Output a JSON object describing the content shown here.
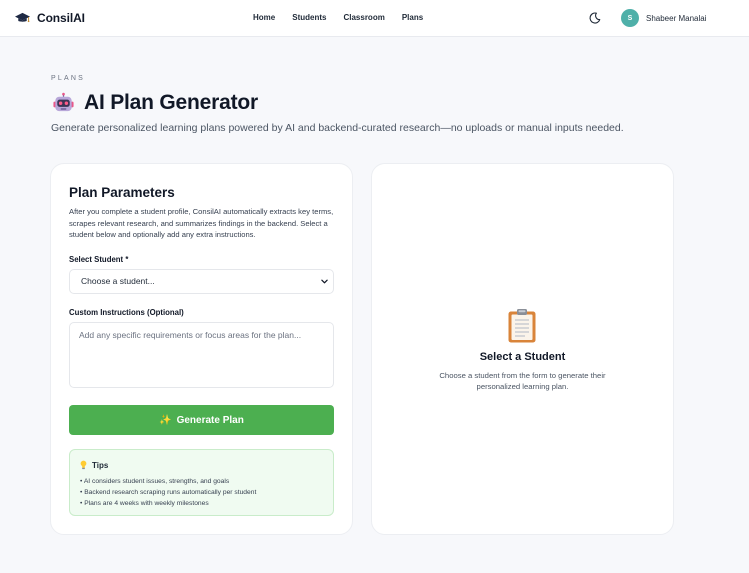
{
  "nav": {
    "brand": "ConsilAI",
    "links": [
      "Home",
      "Students",
      "Classroom",
      "Plans"
    ],
    "avatar_initial": "S",
    "user_name": "Shabeer Manalai"
  },
  "header": {
    "eyebrow": "PLANS",
    "title": "AI Plan Generator",
    "subtitle": "Generate personalized learning plans powered by AI and backend-curated research—no uploads or manual inputs needed."
  },
  "form": {
    "title": "Plan Parameters",
    "description": "After you complete a student profile, ConsilAI automatically extracts key terms, scrapes relevant research, and summarizes findings in the backend. Select a student below and optionally add any extra instructions.",
    "student_label": "Select Student *",
    "student_selected": "Choose a student...",
    "custom_label": "Custom Instructions (Optional)",
    "custom_placeholder": "Add any specific requirements or focus areas for the plan...",
    "generate_label": "Generate Plan",
    "generate_icon": "✨"
  },
  "tips": {
    "title": "Tips",
    "items": [
      "AI considers student issues, strengths, and goals",
      "Backend research scraping runs automatically per student",
      "Plans are 4 weeks with weekly milestones"
    ]
  },
  "empty_state": {
    "title": "Select a Student",
    "description": "Choose a student from the form to generate their personalized learning plan."
  },
  "colors": {
    "accent": "#4caf50",
    "avatar": "#4fb0a9",
    "tips_bg": "#f0fbf1"
  },
  "icons": {
    "brand": "graduation-cap-icon",
    "theme": "moon-icon",
    "title": "robot-icon",
    "tips": "lightbulb-icon",
    "empty": "clipboard-icon"
  }
}
